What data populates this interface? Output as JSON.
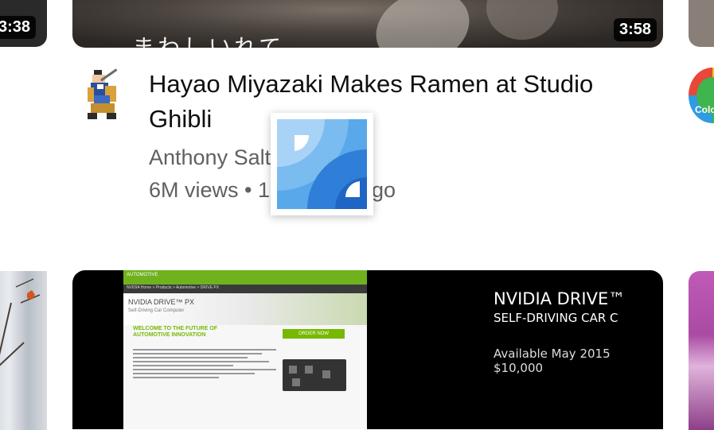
{
  "feed": {
    "top_row": {
      "left_card": {
        "duration": "3:38"
      },
      "main_card": {
        "duration": "3:58",
        "overlay_text": "まわしいれて",
        "title": "Hayao Miyazaki Makes Ramen at Studio Ghibli",
        "channel": "Anthony Salt",
        "meta": "6M views • 1",
        "meta_tail": "go"
      },
      "right_card": {
        "avatar_text": "Colo"
      }
    },
    "bottom_row": {
      "main_card": {
        "web_header": "AUTOMOTIVE",
        "web_breadcrumb": "NVIDIA Home > Products > Automotive > DRIVE PX",
        "web_product": "NVIDIA DRIVE™ PX",
        "web_product_sub": "Self-Driving Car Computer",
        "web_welcome": "WELCOME TO THE FUTURE OF AUTOMOTIVE INNOVATION",
        "web_order": "ORDER NOW",
        "slide_title": "NVIDIA DRIVE™",
        "slide_subtitle": "SELF-DRIVING CAR C",
        "slide_available": "Available May 2015",
        "slide_price": "$10,000"
      }
    }
  },
  "overlay": {
    "icon": "app-icon"
  },
  "colors": {
    "nvidia_green": "#76b900",
    "overlay_blue": "#4a9ee6"
  }
}
